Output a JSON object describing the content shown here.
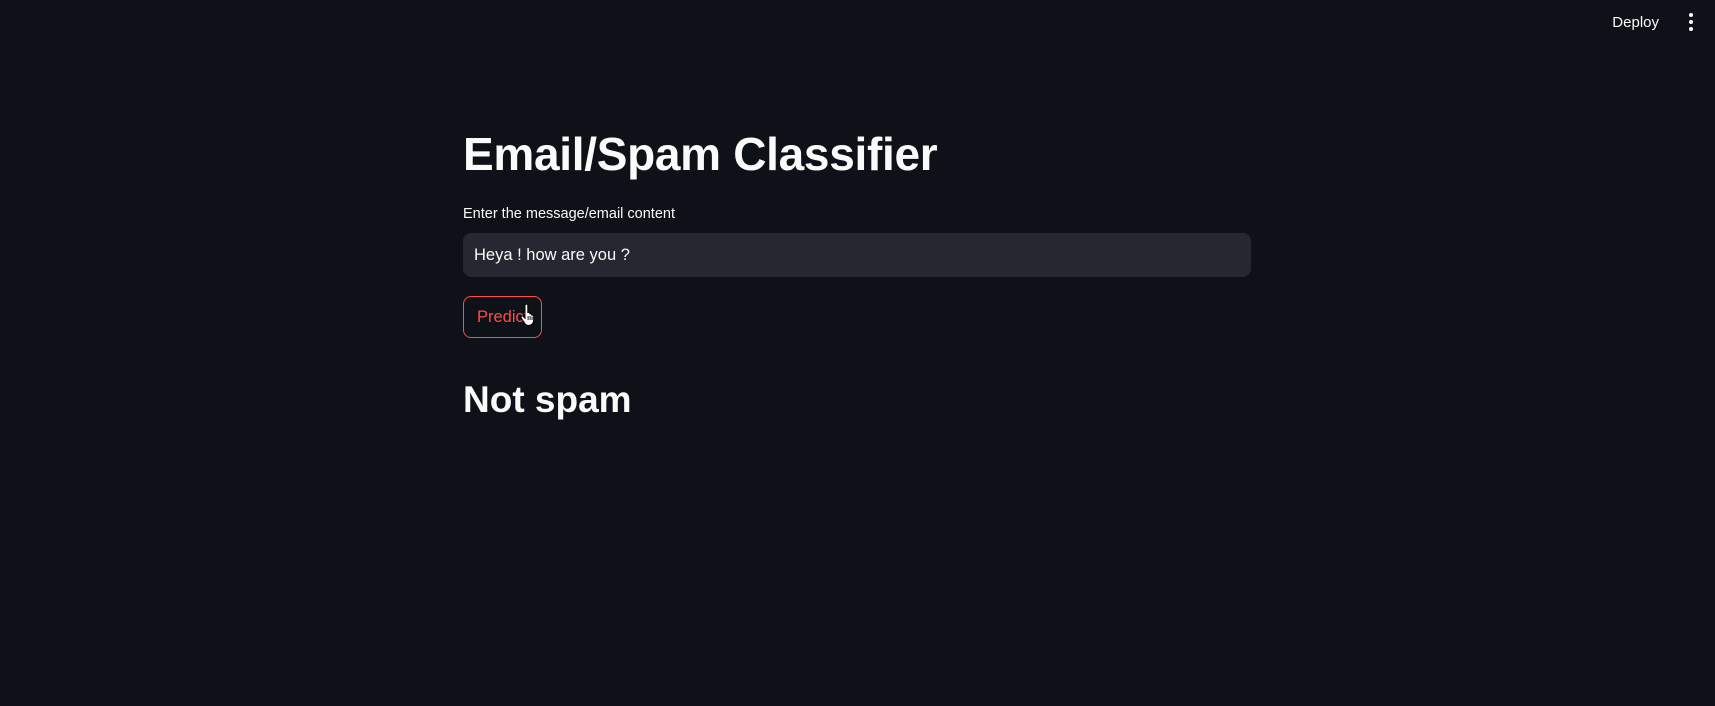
{
  "header": {
    "deploy_label": "Deploy",
    "menu_icon": "vertical-ellipsis-icon"
  },
  "main": {
    "title": "Email/Spam Classifier",
    "input_label": "Enter the message/email content",
    "input_value": "Heya ! how are you ?",
    "predict_label": "Predict",
    "result": "Not spam"
  },
  "colors": {
    "background": "#0e1117",
    "input_background": "#262730",
    "accent": "#ff4b4b",
    "text": "#fafafa"
  }
}
